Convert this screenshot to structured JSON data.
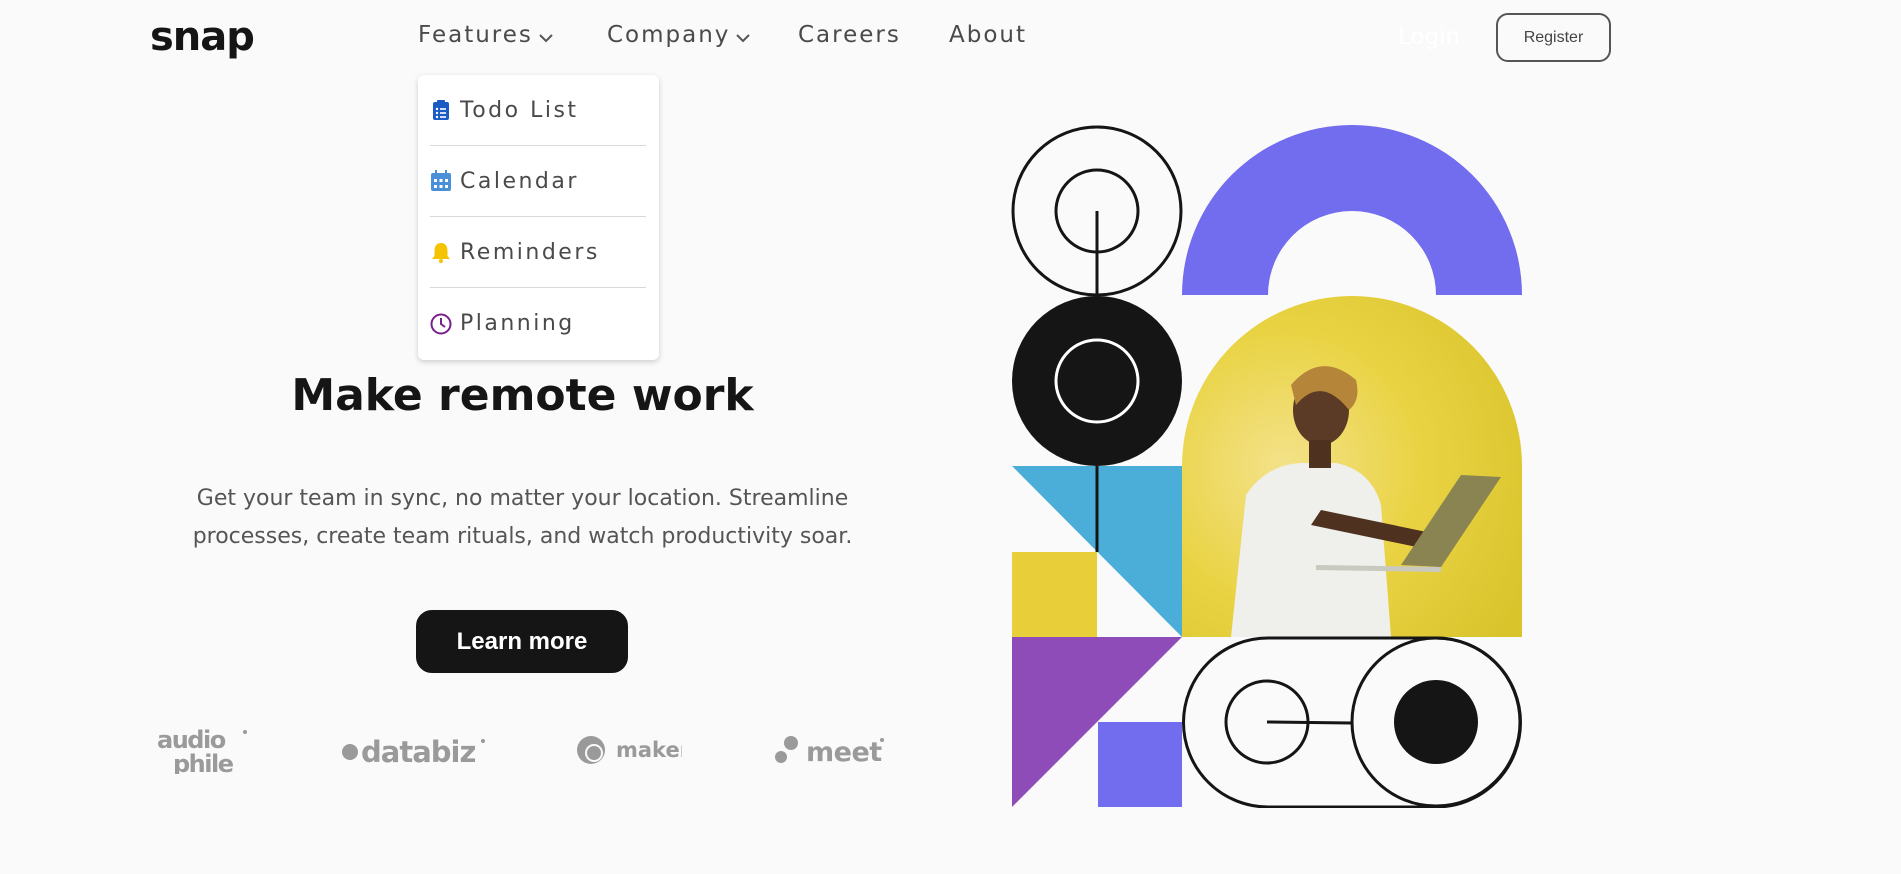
{
  "header": {
    "logo": "snap",
    "nav": [
      {
        "label": "Features",
        "has_dropdown": true
      },
      {
        "label": "Company",
        "has_dropdown": true
      },
      {
        "label": "Careers",
        "has_dropdown": false
      },
      {
        "label": "About",
        "has_dropdown": false
      }
    ],
    "login_label": "Login",
    "register_label": "Register"
  },
  "features_dropdown": {
    "items": [
      {
        "label": "Todo List",
        "icon": "todo-list-icon",
        "color": "#1a5bc4"
      },
      {
        "label": "Calendar",
        "icon": "calendar-icon",
        "color": "#4a90d9"
      },
      {
        "label": "Reminders",
        "icon": "bell-icon",
        "color": "#f5c300"
      },
      {
        "label": "Planning",
        "icon": "clock-icon",
        "color": "#7a1f8c"
      }
    ]
  },
  "hero": {
    "title": "Make remote work",
    "description": "Get your team in sync, no matter your location. Streamline processes, create team rituals, and watch productivity soar.",
    "cta_label": "Learn more"
  },
  "clients": [
    "audiophile",
    "databiz",
    "maker",
    "meet"
  ],
  "colors": {
    "accent_purple": "#726cee",
    "accent_yellow": "#e8cf3a",
    "accent_blue": "#4aaed9",
    "accent_violet": "#8e4cb8",
    "dark": "#151515"
  }
}
